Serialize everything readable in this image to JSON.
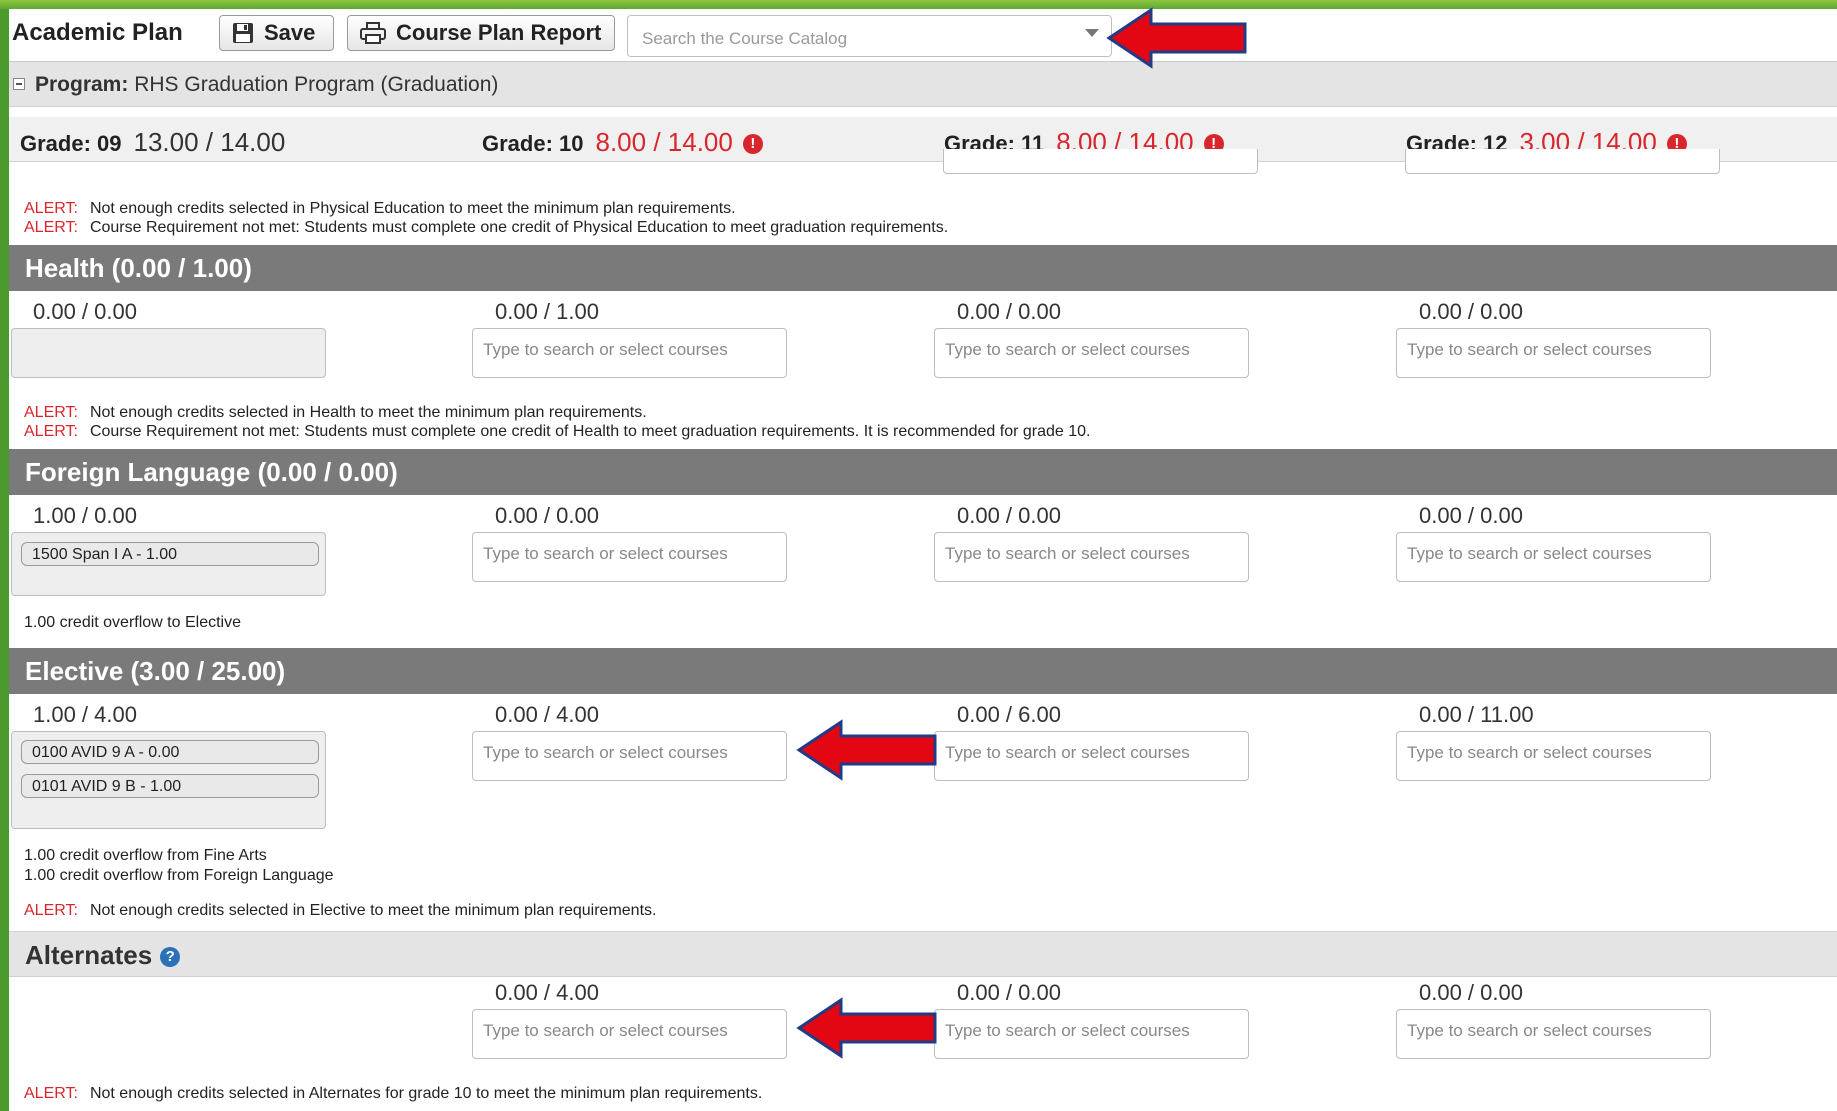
{
  "app": {
    "title": "Academic Plan"
  },
  "toolbar": {
    "save_label": "Save",
    "report_label": "Course Plan Report"
  },
  "search": {
    "placeholder": "Search the Course Catalog"
  },
  "program": {
    "label": "Program:",
    "value": "RHS Graduation Program (Graduation)"
  },
  "grades": [
    {
      "label": "Grade: 09",
      "value": "13.00 / 14.00",
      "warning": false
    },
    {
      "label": "Grade: 10",
      "value": "8.00 / 14.00",
      "warning": true
    },
    {
      "label": "Grade: 11",
      "value": "8.00 / 14.00",
      "warning": true
    },
    {
      "label": "Grade: 12",
      "value": "3.00 / 14.00",
      "warning": true
    }
  ],
  "alert_prefix": "ALERT:",
  "course_placeholder": "Type to search or select courses",
  "pe": {
    "alerts": [
      "Not enough credits selected in Physical Education to meet the minimum plan requirements.",
      "Course Requirement not met: Students must complete one credit of Physical Education to meet graduation requirements."
    ]
  },
  "health": {
    "title": "Health (0.00 / 1.00)",
    "credits": [
      "0.00 / 0.00",
      "0.00 / 1.00",
      "0.00 / 0.00",
      "0.00 / 0.00"
    ],
    "alerts": [
      "Not enough credits selected in Health to meet the minimum plan requirements.",
      "Course Requirement not met: Students must complete one credit of Health to meet graduation requirements. It is recommended for grade 10."
    ]
  },
  "foreign": {
    "title": "Foreign Language (0.00 / 0.00)",
    "credits": [
      "1.00 / 0.00",
      "0.00 / 0.00",
      "0.00 / 0.00",
      "0.00 / 0.00"
    ],
    "courses": [
      "1500 Span I A - 1.00"
    ],
    "notes": [
      "1.00 credit overflow to Elective"
    ]
  },
  "elective": {
    "title": "Elective (3.00 / 25.00)",
    "credits": [
      "1.00 / 4.00",
      "0.00 / 4.00",
      "0.00 / 6.00",
      "0.00 / 11.00"
    ],
    "courses": [
      "0100 AVID 9 A - 0.00",
      "0101 AVID 9 B - 1.00"
    ],
    "notes": [
      "1.00 credit overflow from Fine Arts",
      "1.00 credit overflow from Foreign Language"
    ],
    "alerts": [
      "Not enough credits selected in Elective to meet the minimum plan requirements."
    ]
  },
  "alternates": {
    "title": "Alternates",
    "credits": [
      "0.00 / 4.00",
      "0.00 / 0.00",
      "0.00 / 0.00"
    ],
    "alerts": [
      "Not enough credits selected in Alternates for grade 10 to meet the minimum plan requirements."
    ]
  },
  "colors": {
    "alert": "#d9262c",
    "section_header": "#7a7a7a",
    "arrow": "#e30613",
    "frame": "#4c9a2e"
  },
  "icons": [
    "save-icon",
    "print-icon",
    "dropdown-caret-icon",
    "warning-icon",
    "help-icon",
    "arrow-icon"
  ]
}
